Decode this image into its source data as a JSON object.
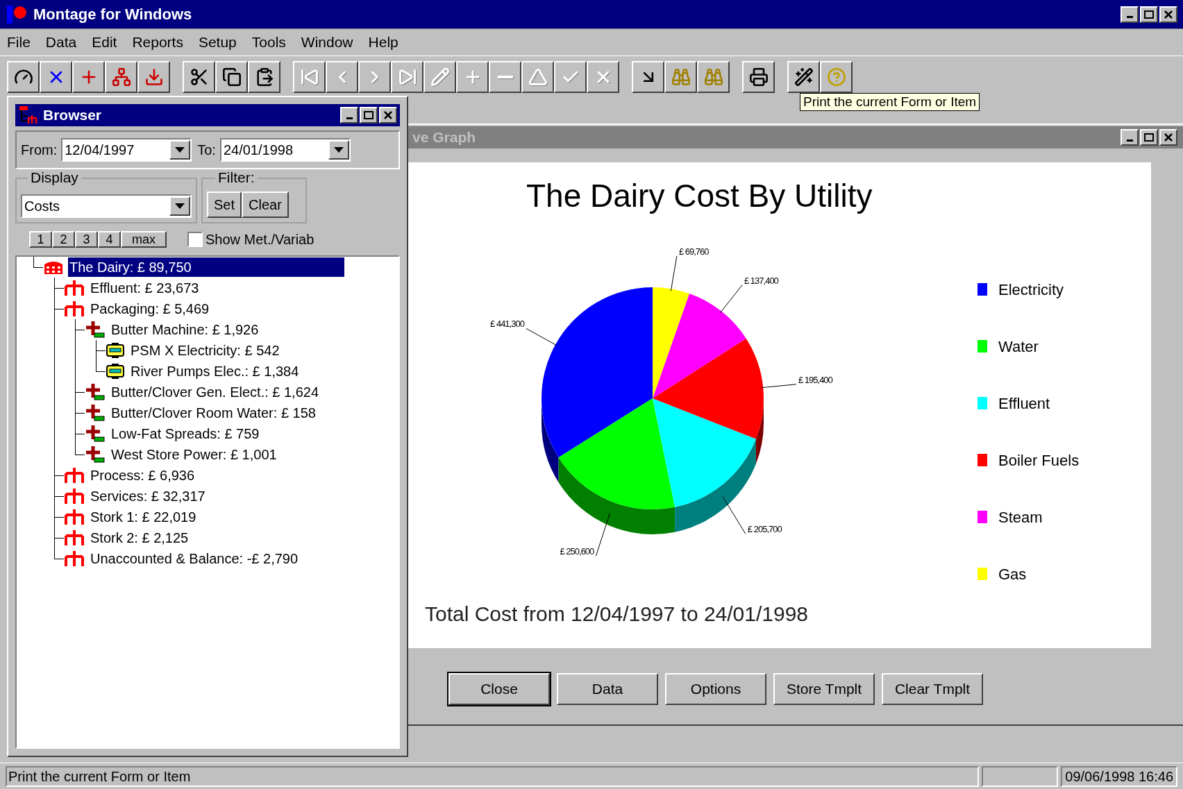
{
  "window": {
    "title": "Montage for Windows"
  },
  "menu": [
    "File",
    "Data",
    "Edit",
    "Reports",
    "Setup",
    "Tools",
    "Window",
    "Help"
  ],
  "toolbar": [
    {
      "buttons": [
        {
          "disabled": false
        },
        {
          "disabled": false
        },
        {
          "disabled": false
        },
        {
          "disabled": false
        },
        {
          "disabled": false
        }
      ]
    },
    {
      "buttons": [
        {
          "disabled": false
        },
        {
          "disabled": false
        },
        {
          "disabled": false
        }
      ]
    },
    {
      "buttons": [
        {
          "disabled": true
        },
        {
          "disabled": true
        },
        {
          "disabled": true
        },
        {
          "disabled": true
        },
        {
          "disabled": true
        },
        {
          "disabled": true
        },
        {
          "disabled": true
        },
        {
          "disabled": true
        },
        {
          "disabled": true
        },
        {
          "disabled": true
        }
      ]
    },
    {
      "buttons": [
        {
          "disabled": false
        },
        {
          "disabled": false
        },
        {
          "disabled": false
        }
      ]
    },
    {
      "buttons": [
        {
          "disabled": false
        }
      ]
    },
    {
      "buttons": [
        {
          "disabled": false
        },
        {
          "disabled": false
        }
      ]
    }
  ],
  "tooltip": "Print the current Form or Item",
  "browser": {
    "title": "Browser",
    "from_label": "From:",
    "from": "12/04/1997",
    "to_label": "To:",
    "to": "24/01/1998",
    "display_label": "Display",
    "display": "Costs",
    "filter_label": "Filter:",
    "filter_buttons": [
      "Set",
      "Clear"
    ],
    "level_buttons": [
      "1",
      "2",
      "3",
      "4",
      "max"
    ],
    "show_checkbox": {
      "label": "Show Met./Variab",
      "checked": false
    },
    "tree": [
      {
        "label": "The Dairy: £ 89,750",
        "kind": "site",
        "selected": true,
        "children": [
          {
            "label": "Effluent: £ 23,673",
            "kind": "department",
            "selected": false
          },
          {
            "label": "Packaging: £ 5,469",
            "kind": "department",
            "selected": false,
            "children": [
              {
                "label": "Butter Machine: £ 1,926",
                "kind": "machine",
                "selected": false,
                "children": [
                  {
                    "label": "PSM X Electricity: £ 542",
                    "kind": "meter",
                    "selected": false
                  },
                  {
                    "label": "River Pumps Elec.: £ 1,384",
                    "kind": "meter",
                    "selected": false
                  }
                ]
              },
              {
                "label": "Butter/Clover Gen. Elect.: £ 1,624",
                "kind": "machine",
                "selected": false
              },
              {
                "label": "Butter/Clover Room Water: £ 158",
                "kind": "machine",
                "selected": false
              },
              {
                "label": "Low-Fat Spreads: £ 759",
                "kind": "machine",
                "selected": false
              },
              {
                "label": "West Store Power: £ 1,001",
                "kind": "machine",
                "selected": false
              }
            ]
          },
          {
            "label": "Process: £ 6,936",
            "kind": "department",
            "selected": false
          },
          {
            "label": "Services: £ 32,317",
            "kind": "department",
            "selected": false
          },
          {
            "label": "Stork 1: £ 22,019",
            "kind": "department",
            "selected": false
          },
          {
            "label": "Stork 2: £ 2,125",
            "kind": "department",
            "selected": false
          },
          {
            "label": "Unaccounted & Balance: -£ 2,790",
            "kind": "department",
            "selected": false
          }
        ]
      }
    ]
  },
  "graph": {
    "title": "ve Graph",
    "chart_data": {
      "type": "pie",
      "title": "The Dairy Cost By Utility",
      "categories": [
        "Electricity",
        "Water",
        "Effluent",
        "Boiler Fuels",
        "Steam",
        "Gas"
      ],
      "values": [
        441300,
        250600,
        205700,
        195400,
        137400,
        69760
      ],
      "colors": [
        "#0000ff",
        "#00ff00",
        "#00ffff",
        "#ff0000",
        "#ff00ff",
        "#ffff00"
      ],
      "data_labels": true,
      "value_labels": [
        "£ 441,300",
        "£ 250,600",
        "£ 205,700",
        "£ 195,400",
        "£ 137,400",
        "£ 69,760"
      ]
    },
    "footer": "Total Cost from 12/04/1997 to 24/01/1998",
    "buttons": [
      {
        "label": "Close",
        "default": true
      },
      {
        "label": "Data",
        "default": false
      },
      {
        "label": "Options",
        "default": false
      },
      {
        "label": "Store Tmplt",
        "default": false
      },
      {
        "label": "Clear Tmplt",
        "default": false
      }
    ]
  },
  "status_bar": {
    "message": "Print the current Form or Item",
    "datetime": "09/06/1998 16:46"
  }
}
